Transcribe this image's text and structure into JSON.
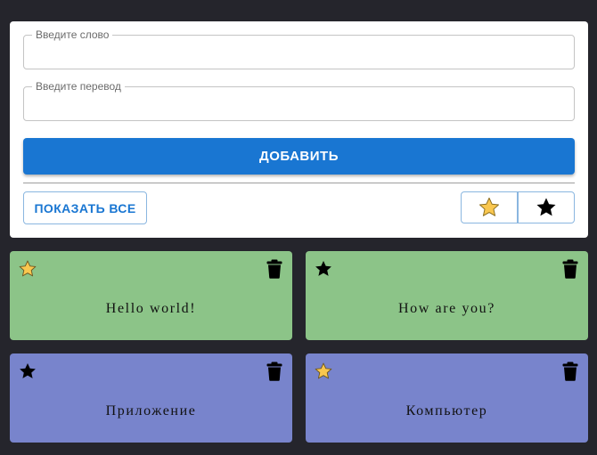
{
  "form": {
    "word_label": "Введите слово",
    "word_value": "",
    "translation_label": "Введите перевод",
    "translation_value": "",
    "add_label": "ДОБАВИТЬ",
    "show_all_label": "ПОКАЗАТЬ ВСЕ",
    "filter_favorites_icon": "star-outline-icon",
    "filter_all_icon": "star-filled-icon"
  },
  "colors": {
    "background": "#25252c",
    "primary": "#1976d2",
    "card_green": "#8cc488",
    "card_blue": "#7884cc",
    "star_favorite": "#f9c74f"
  },
  "cards": [
    {
      "text": "Hello world!",
      "favorite": true,
      "color": "#8cc488"
    },
    {
      "text": "How are you?",
      "favorite": false,
      "color": "#8cc488"
    },
    {
      "text": "Приложение",
      "favorite": false,
      "color": "#7884cc"
    },
    {
      "text": "Компьютер",
      "favorite": true,
      "color": "#7884cc"
    }
  ]
}
